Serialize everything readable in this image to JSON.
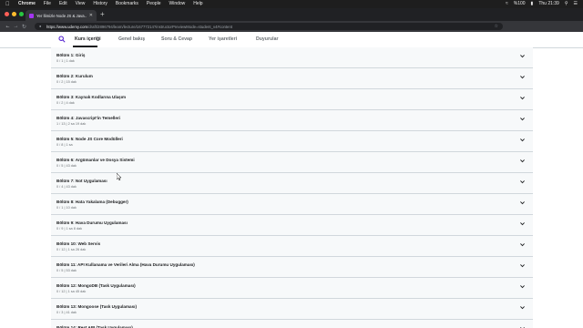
{
  "menubar": {
    "app": "Chrome",
    "items": [
      "File",
      "Edit",
      "View",
      "History",
      "Bookmarks",
      "People",
      "Window",
      "Help"
    ],
    "status": {
      "battery": "%100",
      "time": "Thu 21:39"
    }
  },
  "browser": {
    "tab_title": "Yer İlimizle Node JS & Java...",
    "url_host": "https://www.udemy.com",
    "url_path": "/draft/2896794/learn/lecture/16777214?instructorPreviewMode=student_v4#content",
    "colors": {
      "tabbar": "#202124",
      "toolbar": "#35363a",
      "favicon": "#a435f0"
    }
  },
  "nav": {
    "tabs": [
      {
        "label": "Kurs içeriği",
        "active": true
      },
      {
        "label": "Genel bakış",
        "active": false
      },
      {
        "label": "Soru & Cevap",
        "active": false
      },
      {
        "label": "Yer işaretleri",
        "active": false
      },
      {
        "label": "Duyurular",
        "active": false
      }
    ]
  },
  "sections": [
    {
      "title": "Bölüm 1: Giriş",
      "meta": "0 / 1 | 1 dak"
    },
    {
      "title": "Bölüm 2: Kurulum",
      "meta": "0 / 2 | 15 dak"
    },
    {
      "title": "Bölüm 3: Kaynak Kodlarına Ulaşım",
      "meta": "0 / 2 | 4 dak"
    },
    {
      "title": "Bölüm 4: Javascript'in Temelleri",
      "meta": "1 / 13 | 2 sa 19 dak"
    },
    {
      "title": "Bölüm 5: Node JS Core Modülleri",
      "meta": "0 / 8 | 1 sa"
    },
    {
      "title": "Bölüm 6: Argümanlar ve Dosya Sistemi",
      "meta": "0 / 5 | 43 dak"
    },
    {
      "title": "Bölüm 7: Not Uygulaması",
      "meta": "0 / 4 | 43 dak"
    },
    {
      "title": "Bölüm 8: Hata Yakalama (Debugger)",
      "meta": "0 / 1 | 10 dak"
    },
    {
      "title": "Bölüm 9: Hava Durumu Uygulaması",
      "meta": "0 / 9 | 1 sa 8 dak"
    },
    {
      "title": "Bölüm 10: Web Servis",
      "meta": "0 / 12 | 1 sa 26 dak"
    },
    {
      "title": "Bölüm 11: API Kullanama ve Verileri Alma (Hava Durumu Uygulaması)",
      "meta": "0 / 5 | 53 dak"
    },
    {
      "title": "Bölüm 12: MongoDB (Task Uygulaması)",
      "meta": "0 / 12 | 1 sa 45 dak"
    },
    {
      "title": "Bölüm 13: Mongoose (Task Uygulaması)",
      "meta": "0 / 3 | 41 dak"
    },
    {
      "title": "Bölüm 14: Rest API (Task Uygulaması)",
      "meta": ""
    }
  ]
}
